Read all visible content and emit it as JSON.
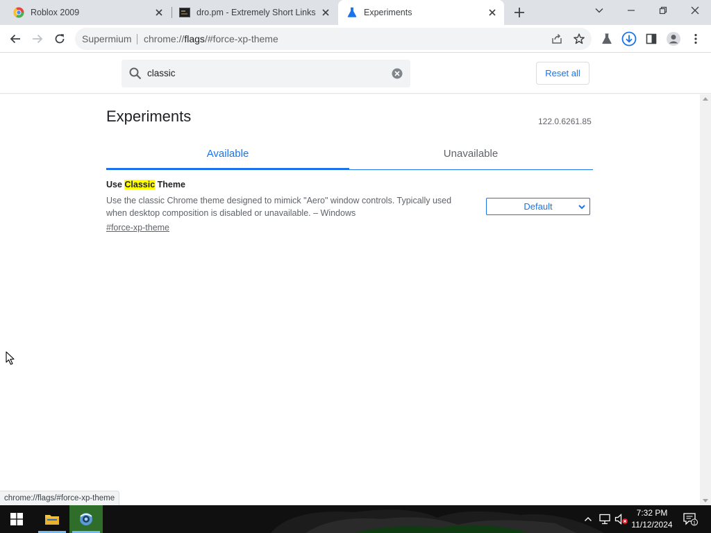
{
  "browser": {
    "tabs": [
      {
        "title": "Roblox 2009",
        "icon": "chromium-logo-icon",
        "active": false
      },
      {
        "title": "dro.pm - Extremely Short Links",
        "icon": "site-favicon-icon",
        "active": false
      },
      {
        "title": "Experiments",
        "icon": "flask-icon",
        "active": true
      }
    ],
    "site_label": "Supermium",
    "url_prefix": "chrome://",
    "url_host": "flags",
    "url_suffix": "/#force-xp-theme"
  },
  "flags": {
    "search_value": "classic",
    "reset_label": "Reset all",
    "heading": "Experiments",
    "version": "122.0.6261.85",
    "tab_available": "Available",
    "tab_unavailable": "Unavailable",
    "experiment": {
      "title_before": "Use ",
      "title_highlight": "Classic",
      "title_after": " Theme",
      "description": "Use the classic Chrome theme designed to mimick \"Aero\" window controls. Typically used when desktop composition is disabled or unavailable. – Windows",
      "link": "#force-xp-theme",
      "selected": "Default"
    }
  },
  "status_url": "chrome://flags/#force-xp-theme",
  "taskbar": {
    "time": "7:32 PM",
    "date": "11/12/2024",
    "notification_count": "1"
  },
  "colors": {
    "accent": "#1a73e8",
    "tabstrip": "#dee1e6",
    "highlight": "#ffff00",
    "taskbar_active": "#2f6e2a"
  }
}
